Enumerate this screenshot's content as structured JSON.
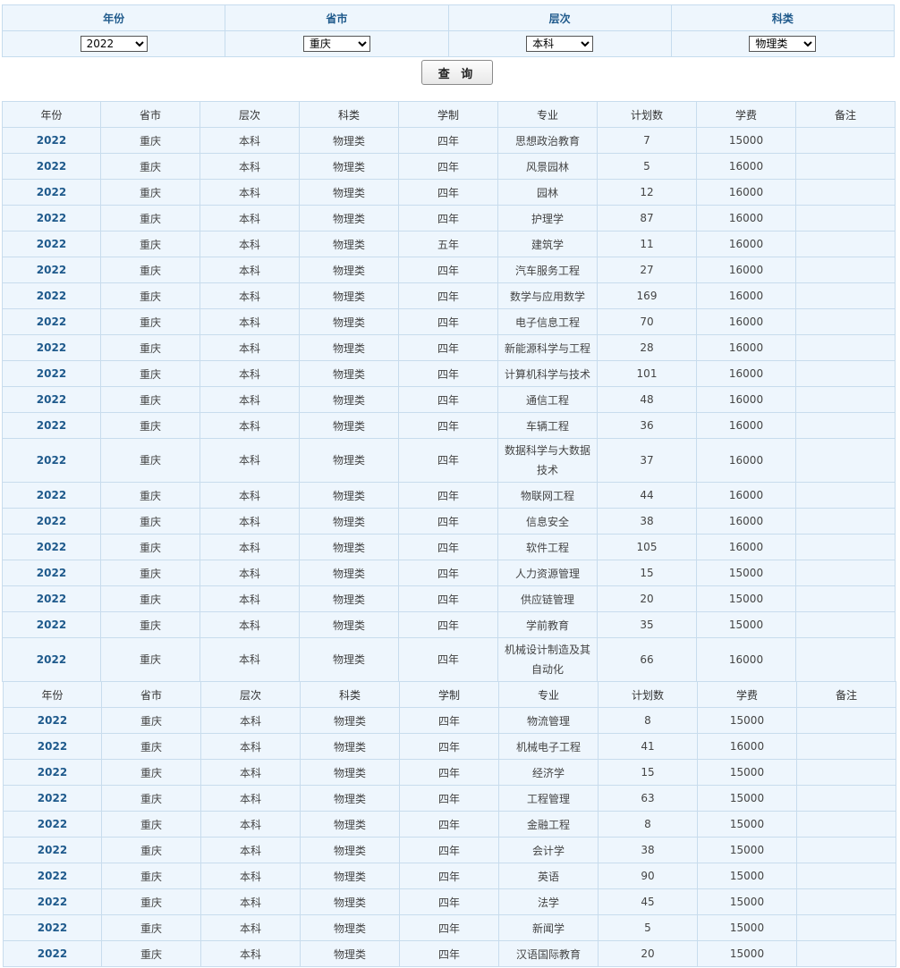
{
  "filters": {
    "labels": {
      "year": "年份",
      "province": "省市",
      "level": "层次",
      "type": "科类"
    },
    "values": {
      "year": "2022",
      "province": "重庆",
      "level": "本科",
      "type": "物理类"
    }
  },
  "query_button": "查 询",
  "table": {
    "headers": [
      "年份",
      "省市",
      "层次",
      "科类",
      "学制",
      "专业",
      "计划数",
      "学费",
      "备注"
    ],
    "rows_part1": [
      [
        "2022",
        "重庆",
        "本科",
        "物理类",
        "四年",
        "思想政治教育",
        "7",
        "15000",
        ""
      ],
      [
        "2022",
        "重庆",
        "本科",
        "物理类",
        "四年",
        "风景园林",
        "5",
        "16000",
        ""
      ],
      [
        "2022",
        "重庆",
        "本科",
        "物理类",
        "四年",
        "园林",
        "12",
        "16000",
        ""
      ],
      [
        "2022",
        "重庆",
        "本科",
        "物理类",
        "四年",
        "护理学",
        "87",
        "16000",
        ""
      ],
      [
        "2022",
        "重庆",
        "本科",
        "物理类",
        "五年",
        "建筑学",
        "11",
        "16000",
        ""
      ],
      [
        "2022",
        "重庆",
        "本科",
        "物理类",
        "四年",
        "汽车服务工程",
        "27",
        "16000",
        ""
      ],
      [
        "2022",
        "重庆",
        "本科",
        "物理类",
        "四年",
        "数学与应用数学",
        "169",
        "16000",
        ""
      ],
      [
        "2022",
        "重庆",
        "本科",
        "物理类",
        "四年",
        "电子信息工程",
        "70",
        "16000",
        ""
      ],
      [
        "2022",
        "重庆",
        "本科",
        "物理类",
        "四年",
        "新能源科学与工程",
        "28",
        "16000",
        ""
      ],
      [
        "2022",
        "重庆",
        "本科",
        "物理类",
        "四年",
        "计算机科学与技术",
        "101",
        "16000",
        ""
      ],
      [
        "2022",
        "重庆",
        "本科",
        "物理类",
        "四年",
        "通信工程",
        "48",
        "16000",
        ""
      ],
      [
        "2022",
        "重庆",
        "本科",
        "物理类",
        "四年",
        "车辆工程",
        "36",
        "16000",
        ""
      ],
      [
        "2022",
        "重庆",
        "本科",
        "物理类",
        "四年",
        "数据科学与大数据技术",
        "37",
        "16000",
        ""
      ],
      [
        "2022",
        "重庆",
        "本科",
        "物理类",
        "四年",
        "物联网工程",
        "44",
        "16000",
        ""
      ],
      [
        "2022",
        "重庆",
        "本科",
        "物理类",
        "四年",
        "信息安全",
        "38",
        "16000",
        ""
      ],
      [
        "2022",
        "重庆",
        "本科",
        "物理类",
        "四年",
        "软件工程",
        "105",
        "16000",
        ""
      ],
      [
        "2022",
        "重庆",
        "本科",
        "物理类",
        "四年",
        "人力资源管理",
        "15",
        "15000",
        ""
      ],
      [
        "2022",
        "重庆",
        "本科",
        "物理类",
        "四年",
        "供应链管理",
        "20",
        "15000",
        ""
      ],
      [
        "2022",
        "重庆",
        "本科",
        "物理类",
        "四年",
        "学前教育",
        "35",
        "15000",
        ""
      ],
      [
        "2022",
        "重庆",
        "本科",
        "物理类",
        "四年",
        "机械设计制造及其自动化",
        "66",
        "16000",
        ""
      ]
    ],
    "rows_part2": [
      [
        "2022",
        "重庆",
        "本科",
        "物理类",
        "四年",
        "物流管理",
        "8",
        "15000",
        ""
      ],
      [
        "2022",
        "重庆",
        "本科",
        "物理类",
        "四年",
        "机械电子工程",
        "41",
        "16000",
        ""
      ],
      [
        "2022",
        "重庆",
        "本科",
        "物理类",
        "四年",
        "经济学",
        "15",
        "15000",
        ""
      ],
      [
        "2022",
        "重庆",
        "本科",
        "物理类",
        "四年",
        "工程管理",
        "63",
        "15000",
        ""
      ],
      [
        "2022",
        "重庆",
        "本科",
        "物理类",
        "四年",
        "金融工程",
        "8",
        "15000",
        ""
      ],
      [
        "2022",
        "重庆",
        "本科",
        "物理类",
        "四年",
        "会计学",
        "38",
        "15000",
        ""
      ],
      [
        "2022",
        "重庆",
        "本科",
        "物理类",
        "四年",
        "英语",
        "90",
        "15000",
        ""
      ],
      [
        "2022",
        "重庆",
        "本科",
        "物理类",
        "四年",
        "法学",
        "45",
        "15000",
        ""
      ],
      [
        "2022",
        "重庆",
        "本科",
        "物理类",
        "四年",
        "新闻学",
        "5",
        "15000",
        ""
      ],
      [
        "2022",
        "重庆",
        "本科",
        "物理类",
        "四年",
        "汉语国际教育",
        "20",
        "15000",
        ""
      ]
    ]
  }
}
